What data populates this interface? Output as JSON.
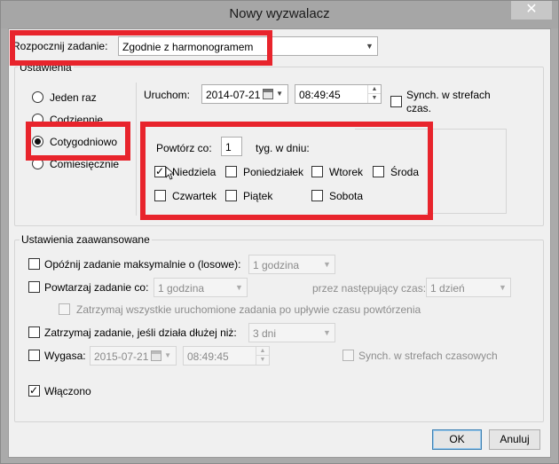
{
  "window": {
    "title": "Nowy wyzwalacz",
    "close_symbol": "✕"
  },
  "top": {
    "start_task_label": "Rozpocznij zadanie:",
    "start_task_value": "Zgodnie z harmonogramem"
  },
  "settings": {
    "group_title": "Ustawienia",
    "radios": [
      {
        "label": "Jeden raz",
        "checked": false
      },
      {
        "label": "Codziennie",
        "checked": false
      },
      {
        "label": "Cotygodniowo",
        "checked": true
      },
      {
        "label": "Comiesięcznie",
        "checked": false
      }
    ],
    "start_label": "Uruchom:",
    "start_date": "2014-07-21",
    "start_time": "08:49:45",
    "sync_label": "Synch. w strefach czas.",
    "sync_line1": "Synch. w strefach",
    "sync_line2": "czas.",
    "recur_label": "Powtórz co:",
    "recur_value": "1",
    "recur_unit": "tyg. w dniu:",
    "days": [
      {
        "label": "Niedziela",
        "checked": true
      },
      {
        "label": "Poniedziałek",
        "checked": false
      },
      {
        "label": "Wtorek",
        "checked": false
      },
      {
        "label": "Środa",
        "checked": false
      },
      {
        "label": "Czwartek",
        "checked": false
      },
      {
        "label": "Piątek",
        "checked": false
      },
      {
        "label": "Sobota",
        "checked": false
      }
    ]
  },
  "advanced": {
    "group_title": "Ustawienia zaawansowane",
    "delay_label": "Opóźnij zadanie maksymalnie o (losowe):",
    "delay_value": "1 godzina",
    "repeat_label": "Powtarzaj zadanie co:",
    "repeat_value": "1 godzina",
    "duration_label": "przez następujący czas:",
    "duration_value": "1 dzień",
    "stop_all_label": "Zatrzymaj wszystkie uruchomione zadania po upływie czasu powtórzenia",
    "stop_if_label": "Zatrzymaj zadanie, jeśli działa dłużej niż:",
    "stop_if_value": "3 dni",
    "expire_label": "Wygasa:",
    "expire_date": "2015-07-21",
    "expire_time": "08:49:45",
    "expire_sync_label": "Synch. w strefach czasowych",
    "enabled_label": "Włączono",
    "enabled_checked": true
  },
  "buttons": {
    "ok": "OK",
    "cancel": "Anuluj"
  },
  "colors": {
    "highlight": "#e8242c",
    "dialog_bg": "#f0f0f0",
    "title_bg": "#a6a6a6"
  }
}
